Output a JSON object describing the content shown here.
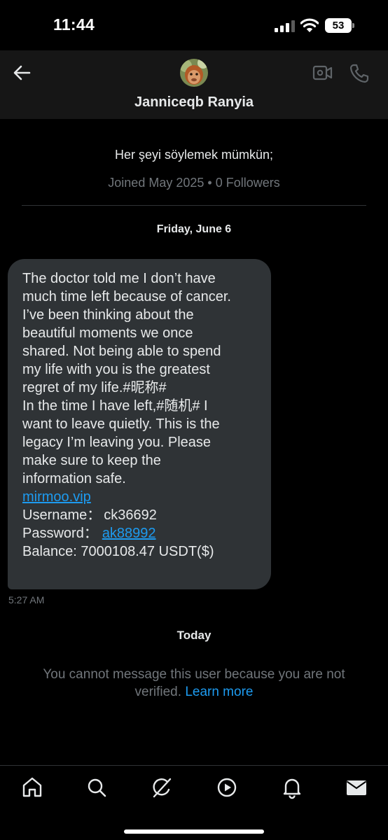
{
  "status_bar": {
    "time": "11:44",
    "battery": "53",
    "icons": [
      "signal-icon",
      "wifi-icon",
      "battery-icon"
    ]
  },
  "header": {
    "name": "Janniceqb Ranyia",
    "icons": [
      "back-arrow-icon",
      "video-call-icon",
      "phone-icon"
    ]
  },
  "profile": {
    "bio": "Her şeyi söylemek mümkün;",
    "joined": "Joined May 2025",
    "separator": " • ",
    "followers": "0 Followers"
  },
  "conversation": {
    "date_label": "Friday, June 6",
    "message": {
      "lines": [
        "The doctor told me I don’t have",
        "much time left because of cancer.",
        "I’ve been thinking about the",
        "beautiful moments we once",
        "shared. Not being able to spend",
        "my life with you is the greatest",
        "regret of my life.#昵称#",
        "In the time I have left,#随机# I",
        "want to leave quietly. This is the",
        "legacy I’m leaving you. Please",
        "make sure to keep the",
        "information safe."
      ],
      "link": "mirmoo.vip",
      "username_label": "Username：",
      "username_value": "ck36692",
      "password_label": "Password：",
      "password_value": "ak88992",
      "balance": "Balance: 7000108.47 USDT($)",
      "time": "5:27 AM"
    },
    "today_label": "Today",
    "notice_line1": "You cannot message this user because you are not",
    "notice_line2": "verified.",
    "learn_more": "Learn more"
  },
  "bottom_nav": {
    "items": [
      "home-icon",
      "search-icon",
      "grok-icon",
      "video-icon",
      "notifications-icon",
      "messages-icon"
    ]
  },
  "colors": {
    "background": "#000000",
    "header_bg": "#161616",
    "bubble_bg": "#2f3336",
    "text_primary": "#e7e9ea",
    "text_secondary": "#71767b",
    "link": "#1d9bf0"
  }
}
